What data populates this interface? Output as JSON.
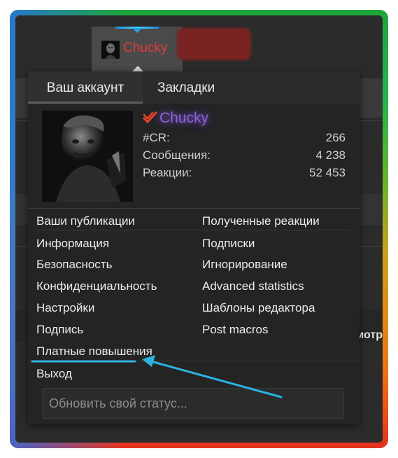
{
  "account_tab": {
    "username": "Chucky"
  },
  "popup": {
    "tabs": [
      {
        "label": "Ваш аккаунт"
      },
      {
        "label": "Закладки"
      }
    ],
    "profile": {
      "username": "Chucky",
      "stats": [
        {
          "label": "#CR:",
          "value": "266"
        },
        {
          "label": "Сообщения:",
          "value": "4 238"
        },
        {
          "label": "Реакции:",
          "value": "52 453"
        }
      ]
    },
    "menu": {
      "publications": "Ваши публикации",
      "reactions_received": "Полученные реакции",
      "info": "Информация",
      "subscriptions": "Подписки",
      "security": "Безопасность",
      "ignore": "Игнорирование",
      "privacy": "Конфиденциальность",
      "advanced_stats": "Advanced statistics",
      "settings": "Настройки",
      "editor_templates": "Шаблоны редактора",
      "signature": "Подпись",
      "post_macros": "Post macros",
      "paid_upgrades": "Платные повышения",
      "logout": "Выход"
    },
    "status_placeholder": "Обновить свой статус..."
  },
  "background": {
    "peek_text": "мотр"
  },
  "colors": {
    "username_tab": "#e23a3a",
    "username_profile": "#8a63d6",
    "verified_check": "#e0442e",
    "annotation": "#2bb3e0"
  }
}
